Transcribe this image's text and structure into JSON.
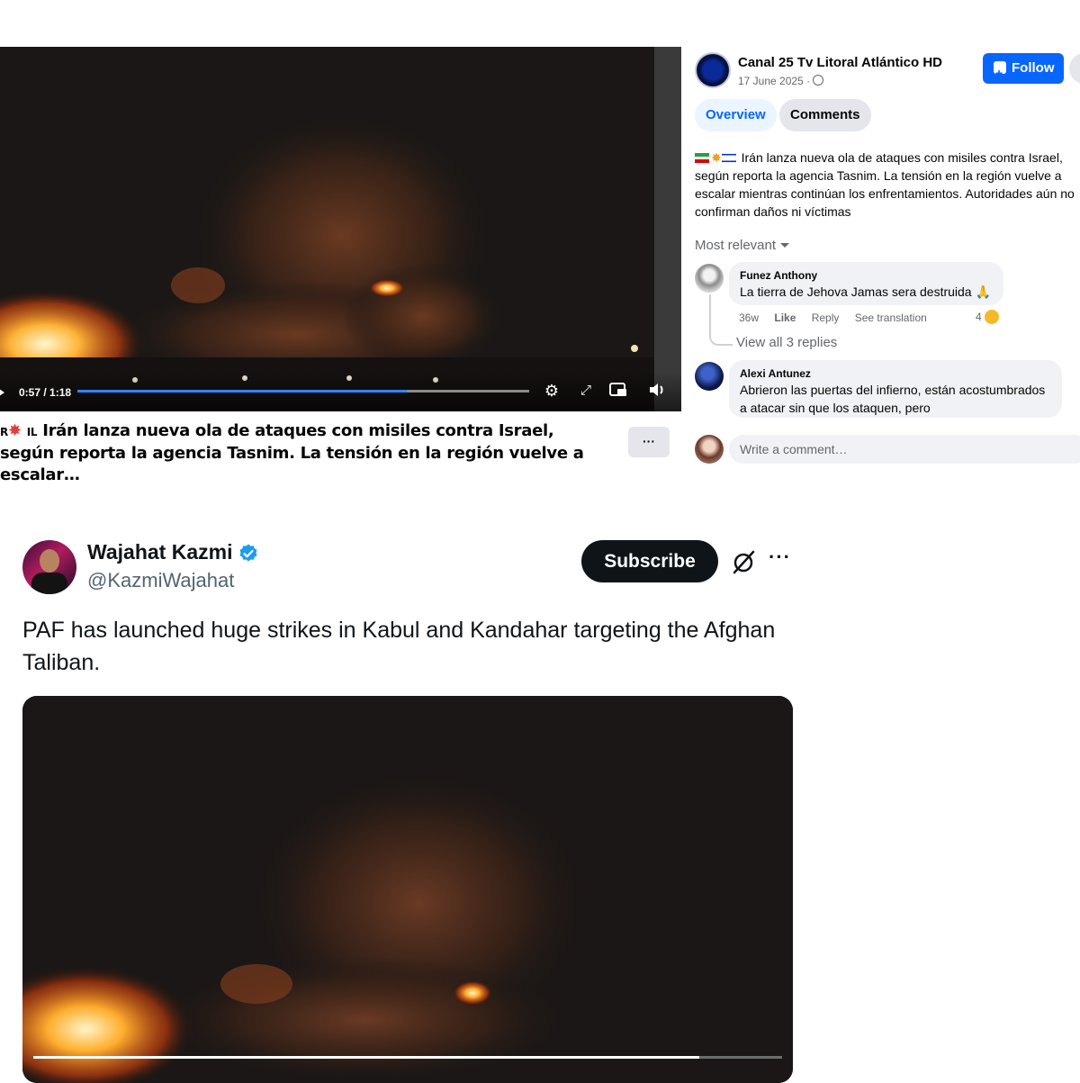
{
  "facebook": {
    "video": {
      "time": "0:57 / 1:18",
      "progress": 0.73
    },
    "caption": "Irán lanza nueva ola de ataques con misiles contra Israel, según reporta la agencia Tasnim. La tensión en la región vuelve a escalar…",
    "caption_prefix": "R",
    "caption_emoji_label": "IL",
    "more_label": "···",
    "page": {
      "name": "Canal 25 Tv Litoral Atlántico HD",
      "date": "17 June 2025 ·",
      "follow_label": "Follow"
    },
    "tabs": [
      "Overview",
      "Comments"
    ],
    "post_text": "Irán lanza nueva ola de ataques con misiles contra Israel, según reporta la agencia Tasnim. La tensión en la región vuelve a escalar mientras continúan los enfrentamientos. Autoridades aún no confirman daños ni víctimas",
    "sort_label": "Most relevant",
    "comments": [
      {
        "name": "Funez Anthony",
        "text": "La tierra de Jehova Jamas sera destruida 🙏",
        "age": "36w",
        "like": "Like",
        "reply": "Reply",
        "translation": "See translation",
        "reactions": "4"
      },
      {
        "name": "Alexi Antunez",
        "text": "Abrieron las puertas del infierno, están acostumbrados a atacar sin que los ataquen, pero"
      }
    ],
    "view_replies": "View all 3 replies",
    "write_placeholder": "Write a comment…"
  },
  "x_post": {
    "name": "Wajahat Kazmi",
    "handle": "@KazmiWajahat",
    "subscribe_label": "Subscribe",
    "more_label": "···",
    "text": "PAF has launched huge strikes in Kabul and Kandahar targeting the Afghan Taliban.",
    "video_progress": 0.89
  },
  "colors": {
    "fb_blue": "#0866ff",
    "x_black": "#0f1419",
    "verified_blue": "#1d9bf0"
  }
}
